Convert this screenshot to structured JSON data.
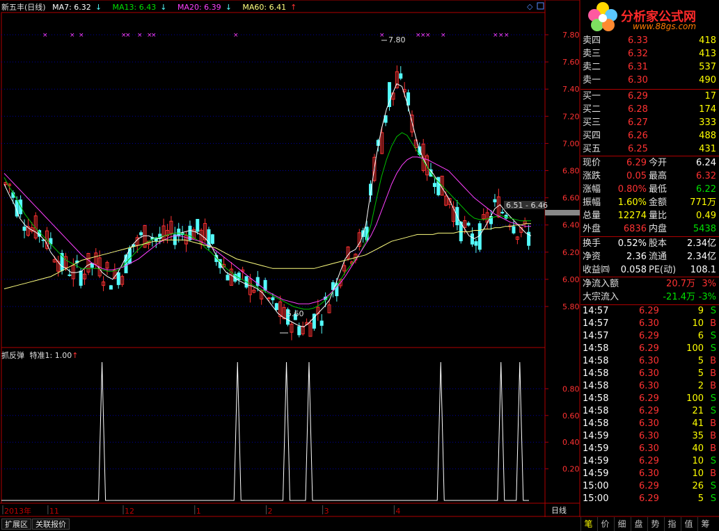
{
  "header": {
    "title": "新五丰(日线)",
    "ma7": "MA7: 6.32",
    "ma13": "MA13: 6.43",
    "ma20": "MA20: 6.39",
    "ma60": "MA60: 6.41",
    "arrow_down": "↓",
    "arrow_up": "↑"
  },
  "sub_header": {
    "label": "抓反弹",
    "value": "特准1: 1.00",
    "arrow_up": "↑"
  },
  "annotations": {
    "high_label": "7.80",
    "low_label": "5.60",
    "range_label": "6.51 - 6.46"
  },
  "bottom_bar": {
    "tab1": "扩展区",
    "tab2": "关联报价",
    "period": "日线"
  },
  "logo": {
    "text": "分析家公式网",
    "url": "www.88gs.com"
  },
  "right_tabs": [
    "笔",
    "价",
    "细",
    "盘",
    "势",
    "指",
    "值",
    "筹"
  ],
  "colors": {
    "up": "#ff3232",
    "down": "#54fcfc",
    "ma7": "#ffffff",
    "ma13": "#00c000",
    "ma20": "#ff40ff",
    "ma60": "#ffff80",
    "grid": "#0000a8",
    "border": "#b00000",
    "x_axis_label": "#c00000"
  },
  "order_book": {
    "asks": [
      {
        "label": "卖四",
        "price": "6.33",
        "vol": "418"
      },
      {
        "label": "卖三",
        "price": "6.32",
        "vol": "413"
      },
      {
        "label": "卖二",
        "price": "6.31",
        "vol": "537"
      },
      {
        "label": "卖一",
        "price": "6.30",
        "vol": "490"
      }
    ],
    "bids": [
      {
        "label": "买一",
        "price": "6.29",
        "vol": "17"
      },
      {
        "label": "买二",
        "price": "6.28",
        "vol": "174"
      },
      {
        "label": "买三",
        "price": "6.27",
        "vol": "333"
      },
      {
        "label": "买四",
        "price": "6.26",
        "vol": "488"
      },
      {
        "label": "买五",
        "price": "6.25",
        "vol": "431"
      }
    ]
  },
  "quote": [
    {
      "l1": "现价",
      "v1": "6.29",
      "l2": "今开",
      "v2": "6.24"
    },
    {
      "l1": "涨跌",
      "v1": "0.05",
      "l2": "最高",
      "v2": "6.32"
    },
    {
      "l1": "涨幅",
      "v1": "0.80%",
      "l2": "最低",
      "v2": "6.22"
    },
    {
      "l1": "振幅",
      "v1": "1.60%",
      "l2": "金额",
      "v2": "771万"
    },
    {
      "l1": "总量",
      "v1": "12274",
      "l2": "量比",
      "v2": "0.49"
    },
    {
      "l1": "外盘",
      "v1": "6836",
      "l2": "内盘",
      "v2": "5438"
    }
  ],
  "fundamentals": [
    {
      "l1": "换手",
      "v1": "0.52%",
      "l2": "股本",
      "v2": "2.34亿"
    },
    {
      "l1": "净资",
      "v1": "2.36",
      "l2": "流通",
      "v2": "2.34亿"
    },
    {
      "l1": "收益㈣",
      "v1": "0.058",
      "l2": "PE(动)",
      "v2": "108.1"
    }
  ],
  "flow": [
    {
      "label": "净流入额",
      "value": "20.7万",
      "pct": "3%"
    },
    {
      "label": "大宗流入",
      "value": "-21.4万",
      "pct": "-3%"
    }
  ],
  "ticks": [
    {
      "t": "14:57",
      "p": "6.29",
      "v": "9",
      "s": "S"
    },
    {
      "t": "14:57",
      "p": "6.30",
      "v": "10",
      "s": "B"
    },
    {
      "t": "14:57",
      "p": "6.29",
      "v": "6",
      "s": "S"
    },
    {
      "t": "14:58",
      "p": "6.29",
      "v": "100",
      "s": "S"
    },
    {
      "t": "14:58",
      "p": "6.30",
      "v": "5",
      "s": "B"
    },
    {
      "t": "14:58",
      "p": "6.30",
      "v": "5",
      "s": "B"
    },
    {
      "t": "14:58",
      "p": "6.30",
      "v": "2",
      "s": "B"
    },
    {
      "t": "14:58",
      "p": "6.29",
      "v": "100",
      "s": "S"
    },
    {
      "t": "14:58",
      "p": "6.29",
      "v": "21",
      "s": "S"
    },
    {
      "t": "14:58",
      "p": "6.30",
      "v": "41",
      "s": "B"
    },
    {
      "t": "14:59",
      "p": "6.30",
      "v": "35",
      "s": "B"
    },
    {
      "t": "14:59",
      "p": "6.30",
      "v": "40",
      "s": "B"
    },
    {
      "t": "14:59",
      "p": "6.29",
      "v": "10",
      "s": "S"
    },
    {
      "t": "14:59",
      "p": "6.30",
      "v": "10",
      "s": "B"
    },
    {
      "t": "15:00",
      "p": "6.29",
      "v": "26",
      "s": "S"
    },
    {
      "t": "15:00",
      "p": "6.29",
      "v": "5",
      "s": "S"
    }
  ],
  "chart_data": [
    {
      "type": "candlestick",
      "ylim": [
        5.65,
        7.92
      ],
      "y_ticks": [
        "7.80",
        "7.60",
        "7.40",
        "7.20",
        "7.00",
        "6.80",
        "6.60",
        "6.40",
        "6.20",
        "6.00",
        "5.80"
      ],
      "y_tick_values": [
        7.8,
        7.6,
        7.4,
        7.2,
        7.0,
        6.8,
        6.6,
        6.4,
        6.2,
        6.0,
        5.8
      ],
      "x_labels": [
        "2013年",
        "11",
        "12",
        "1",
        "2",
        "3",
        "4"
      ],
      "x_label_bar_index": [
        0,
        12,
        32,
        51,
        70,
        85,
        104
      ],
      "current_price": 6.29,
      "peak_bar_index": 77,
      "trough_bar_index": 58,
      "series": [
        {
          "name": "MA7",
          "values": [
            6.7,
            6.62,
            6.55,
            6.45,
            6.4,
            6.37,
            6.35,
            6.32,
            6.28,
            6.2,
            6.15,
            6.1,
            6.08,
            6.05,
            6.05,
            6.06,
            6.1,
            6.12,
            6.1,
            6.05,
            6.02,
            6.0,
            6.05,
            6.12,
            6.2,
            6.26,
            6.3,
            6.32,
            6.32,
            6.3,
            6.3,
            6.32,
            6.33,
            6.34,
            6.34,
            6.35,
            6.36,
            6.35,
            6.33,
            6.3,
            6.25,
            6.18,
            6.1,
            6.05,
            6.03,
            6.0,
            5.98,
            5.96,
            5.95,
            5.93,
            5.9,
            5.85,
            5.8,
            5.75,
            5.72,
            5.7,
            5.68,
            5.66,
            5.65,
            5.68,
            5.72,
            5.76,
            5.8,
            5.85,
            5.95,
            6.05,
            6.15,
            6.2,
            6.22,
            6.28,
            6.4,
            6.65,
            6.9,
            7.1,
            7.25,
            7.35,
            7.44,
            7.42,
            7.3,
            7.15,
            7.0,
            6.9,
            6.82,
            6.78,
            6.72,
            6.66,
            6.6,
            6.52,
            6.44,
            6.38,
            6.32,
            6.3,
            6.32,
            6.38,
            6.45,
            6.52,
            6.55,
            6.5,
            6.46,
            6.42,
            6.38,
            6.34,
            6.32
          ]
        },
        {
          "name": "MA13",
          "values": [
            6.75,
            6.68,
            6.62,
            6.55,
            6.48,
            6.43,
            6.38,
            6.34,
            6.3,
            6.26,
            6.22,
            6.18,
            6.14,
            6.12,
            6.1,
            6.08,
            6.08,
            6.08,
            6.08,
            6.07,
            6.06,
            6.06,
            6.07,
            6.1,
            6.14,
            6.18,
            6.22,
            6.26,
            6.28,
            6.3,
            6.31,
            6.32,
            6.33,
            6.34,
            6.34,
            6.33,
            6.32,
            6.3,
            6.27,
            6.23,
            6.2,
            6.16,
            6.12,
            6.08,
            6.05,
            6.02,
            6.0,
            5.98,
            5.96,
            5.94,
            5.92,
            5.9,
            5.88,
            5.86,
            5.84,
            5.82,
            5.8,
            5.79,
            5.78,
            5.78,
            5.79,
            5.81,
            5.84,
            5.88,
            5.93,
            5.99,
            6.05,
            6.1,
            6.15,
            6.2,
            6.28,
            6.4,
            6.58,
            6.75,
            6.88,
            6.98,
            7.05,
            7.08,
            7.06,
            7.0,
            6.94,
            6.88,
            6.82,
            6.76,
            6.72,
            6.68,
            6.64,
            6.6,
            6.56,
            6.52,
            6.48,
            6.45,
            6.44,
            6.44,
            6.45,
            6.46,
            6.47,
            6.46,
            6.45,
            6.44,
            6.43,
            6.43,
            6.43
          ]
        },
        {
          "name": "MA20",
          "values": [
            6.78,
            6.74,
            6.7,
            6.66,
            6.62,
            6.58,
            6.54,
            6.5,
            6.46,
            6.42,
            6.38,
            6.34,
            6.3,
            6.26,
            6.22,
            6.18,
            6.15,
            6.12,
            6.1,
            6.08,
            6.07,
            6.07,
            6.08,
            6.09,
            6.11,
            6.13,
            6.15,
            6.18,
            6.21,
            6.24,
            6.27,
            6.29,
            6.31,
            6.32,
            6.32,
            6.31,
            6.3,
            6.29,
            6.28,
            6.26,
            6.24,
            6.21,
            6.18,
            6.15,
            6.12,
            6.09,
            6.06,
            6.03,
            6.0,
            5.97,
            5.94,
            5.91,
            5.89,
            5.87,
            5.85,
            5.84,
            5.83,
            5.82,
            5.82,
            5.82,
            5.83,
            5.84,
            5.86,
            5.89,
            5.93,
            5.97,
            6.02,
            6.08,
            6.14,
            6.2,
            6.26,
            6.32,
            6.4,
            6.5,
            6.6,
            6.7,
            6.78,
            6.84,
            6.88,
            6.9,
            6.9,
            6.89,
            6.88,
            6.86,
            6.84,
            6.82,
            6.8,
            6.76,
            6.72,
            6.68,
            6.64,
            6.6,
            6.57,
            6.54,
            6.51,
            6.48,
            6.46,
            6.44,
            6.42,
            6.41,
            6.4,
            6.39,
            6.39
          ]
        },
        {
          "name": "MA60",
          "values": [
            5.93,
            5.94,
            5.95,
            5.96,
            5.97,
            5.98,
            5.99,
            6.0,
            6.01,
            6.02,
            6.04,
            6.06,
            6.08,
            6.1,
            6.12,
            6.14,
            6.15,
            6.16,
            6.17,
            6.18,
            6.19,
            6.2,
            6.21,
            6.22,
            6.23,
            6.24,
            6.25,
            6.26,
            6.27,
            6.28,
            6.28,
            6.29,
            6.29,
            6.29,
            6.29,
            6.29,
            6.28,
            6.27,
            6.26,
            6.25,
            6.24,
            6.23,
            6.21,
            6.19,
            6.17,
            6.15,
            6.14,
            6.13,
            6.12,
            6.11,
            6.1,
            6.09,
            6.08,
            6.08,
            6.08,
            6.08,
            6.08,
            6.08,
            6.08,
            6.08,
            6.08,
            6.09,
            6.1,
            6.11,
            6.12,
            6.13,
            6.14,
            6.15,
            6.16,
            6.17,
            6.18,
            6.2,
            6.22,
            6.24,
            6.26,
            6.28,
            6.29,
            6.3,
            6.31,
            6.32,
            6.33,
            6.33,
            6.33,
            6.33,
            6.34,
            6.34,
            6.34,
            6.34,
            6.35,
            6.35,
            6.35,
            6.36,
            6.36,
            6.37,
            6.37,
            6.38,
            6.38,
            6.39,
            6.39,
            6.4,
            6.4,
            6.41,
            6.41
          ]
        }
      ]
    },
    {
      "type": "line",
      "name": "抓反弹",
      "ylim": [
        0,
        1
      ],
      "y_ticks": [
        "0.80",
        "0.60",
        "0.40",
        "0.20"
      ],
      "y_tick_values": [
        0.8,
        0.6,
        0.4,
        0.2
      ],
      "signal_bar_indices": [
        26,
        62,
        75,
        81,
        116,
        132,
        137
      ]
    }
  ]
}
